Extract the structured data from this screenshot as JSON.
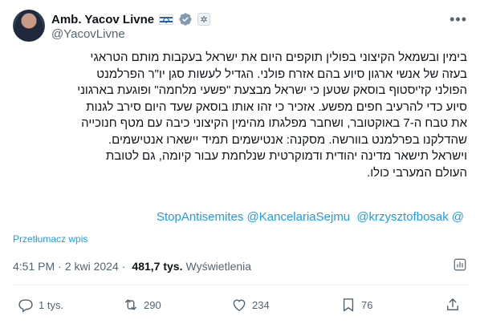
{
  "author": {
    "display_name": "Amb. Yacov Livne",
    "handle": "@YacovLivne"
  },
  "tweet": {
    "lines": [
      "בימין ובשמאל הקיצוני בפולין תוקפים היום את ישראל בעקבות מותם הטראגי",
      "בעזה של אנשי ארגון סיוע בהם אזרח פולני. הגדיל לעשות סגן יו\"ר הפרלמנט",
      "הפולני קז'יסטוף בוסאק שטען כי ישראל מבצעת \"פשעי מלחמה\" ופוגעת בארגוני",
      "סיוע כדי להרעיב חפים מפשע. אזכיר כי זהו אותו בוסאק שעד היום סירב לגנות",
      "את טבח ה-7 באוקטובר, ושחבר מפלגתו מהימין הקיצוני כיבה עם מטף חנוכייה",
      "שהדלקנו בפרלמנט בוורשה. מסקנה: אנטישמים תמיד יישארו אנטישמים.",
      "וישראל תישאר מדינה יהודית ודמוקרטית שנלחמת עבור קיומה, גם לטובת",
      "העולם המערבי כולו."
    ],
    "mentions": [
      "@StopAntisemites",
      "@KancelariaSejmu",
      "@krzysztofbosak"
    ],
    "translate_label": "Przetłumacz wpis"
  },
  "meta": {
    "time": "4:51 PM",
    "date": "2 kwi 2024",
    "views_count": "481,7 tys.",
    "views_label": "Wyświetlenia"
  },
  "actions": {
    "replies": "1 tys.",
    "reposts": "290",
    "likes": "234",
    "bookmarks": "76"
  },
  "colors": {
    "accent": "#1d9bf0",
    "secondary_text": "#536471",
    "primary_text": "#0f1419"
  }
}
